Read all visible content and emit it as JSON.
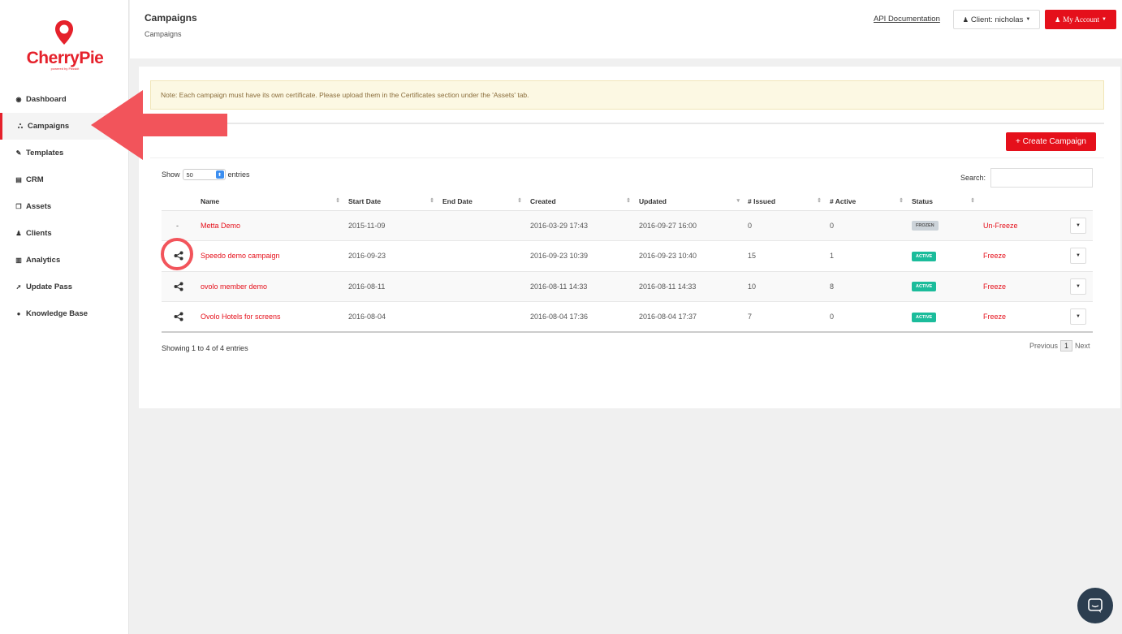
{
  "brand": {
    "name": "CherryPie",
    "tagline": "powered by Passkit",
    "color": "#e5212b"
  },
  "sidebar": {
    "items": [
      {
        "label": "Dashboard",
        "icon": "dashboard-icon"
      },
      {
        "label": "Campaigns",
        "icon": "sitemap-icon",
        "active": true
      },
      {
        "label": "Templates",
        "icon": "pencil-icon"
      },
      {
        "label": "CRM",
        "icon": "database-icon"
      },
      {
        "label": "Assets",
        "icon": "files-icon"
      },
      {
        "label": "Clients",
        "icon": "user-icon"
      },
      {
        "label": "Analytics",
        "icon": "bar-chart-icon"
      },
      {
        "label": "Update Pass",
        "icon": "rocket-icon"
      },
      {
        "label": "Knowledge Base",
        "icon": "question-circle-icon"
      }
    ]
  },
  "header": {
    "title": "Campaigns",
    "breadcrumb": "Campaigns",
    "api_link": "API Documentation",
    "client_button": "Client: nicholas",
    "account_button": "My Account"
  },
  "note": "Note: Each campaign must have its own certificate. Please upload them in the Certificates section under the 'Assets' tab.",
  "create_button": "+ Create Campaign",
  "table_controls": {
    "show_label": "Show",
    "entries_value": "50",
    "entries_label": "entries",
    "search_label": "Search:"
  },
  "table": {
    "columns": [
      "Name",
      "Start Date",
      "End Date",
      "Created",
      "Updated",
      "# Issued",
      "# Active",
      "Status"
    ],
    "rows": [
      {
        "lead": "-",
        "name": "Metta Demo",
        "start": "2015-11-09",
        "end": "",
        "created": "2016-03-29 17:43",
        "updated": "2016-09-27 16:00",
        "issued": "0",
        "active": "0",
        "status": "FROZEN",
        "action": "Un-Freeze"
      },
      {
        "lead": "share",
        "name": "Speedo demo campaign",
        "start": "2016-09-23",
        "end": "",
        "created": "2016-09-23 10:39",
        "updated": "2016-09-23 10:40",
        "issued": "15",
        "active": "1",
        "status": "ACTIVE",
        "action": "Freeze"
      },
      {
        "lead": "share",
        "name": "ovolo member demo",
        "start": "2016-08-11",
        "end": "",
        "created": "2016-08-11 14:33",
        "updated": "2016-08-11 14:33",
        "issued": "10",
        "active": "8",
        "status": "ACTIVE",
        "action": "Freeze"
      },
      {
        "lead": "share",
        "name": "Ovolo Hotels for screens",
        "start": "2016-08-04",
        "end": "",
        "created": "2016-08-04 17:36",
        "updated": "2016-08-04 17:37",
        "issued": "7",
        "active": "0",
        "status": "ACTIVE",
        "action": "Freeze"
      }
    ]
  },
  "footer": {
    "info": "Showing 1 to 4 of 4 entries",
    "previous": "Previous",
    "page": "1",
    "next": "Next"
  },
  "colors": {
    "accent": "#e5101b",
    "active_badge": "#1bbc9b",
    "frozen_badge": "#ccd3d9",
    "annotation": "#f2545b"
  }
}
